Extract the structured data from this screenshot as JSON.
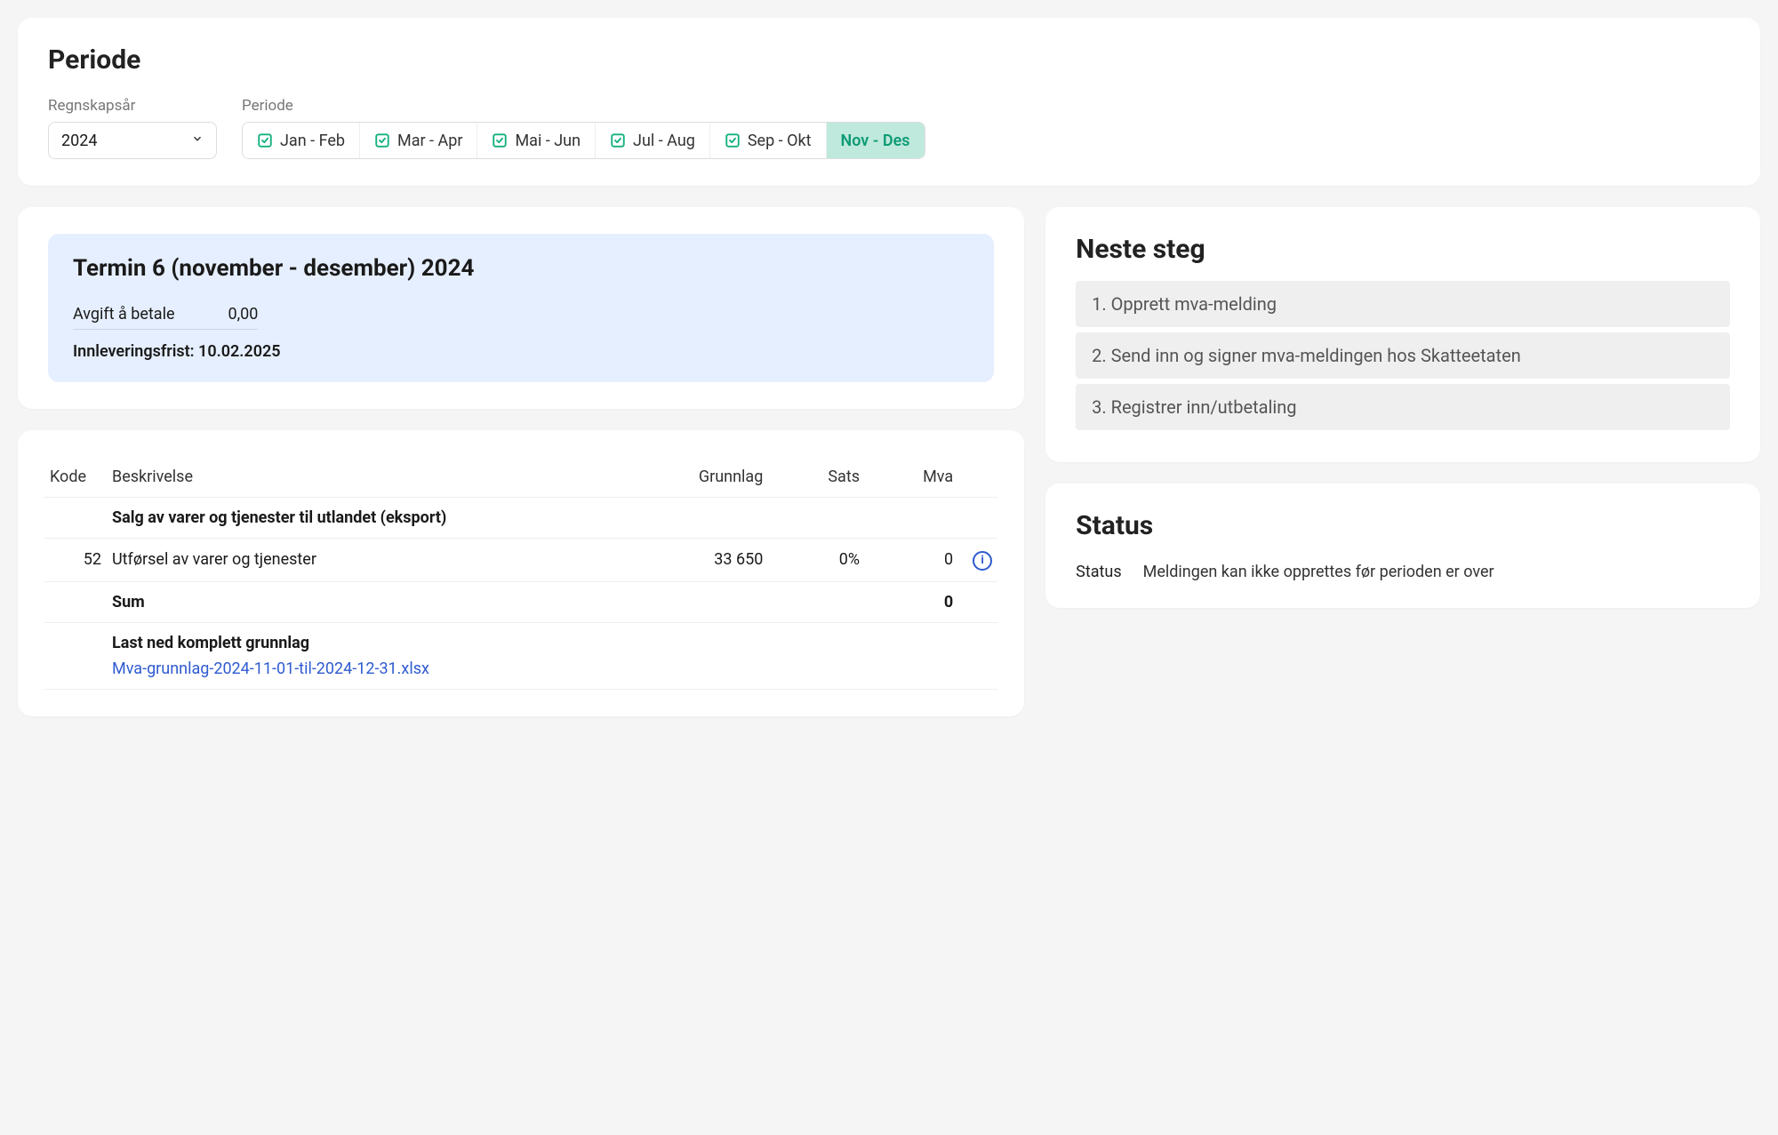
{
  "periode": {
    "title": "Periode",
    "year_label": "Regnskapsår",
    "year_value": "2024",
    "period_label": "Periode",
    "segments": [
      {
        "label": "Jan - Feb",
        "done": true,
        "active": false
      },
      {
        "label": "Mar - Apr",
        "done": true,
        "active": false
      },
      {
        "label": "Mai - Jun",
        "done": true,
        "active": false
      },
      {
        "label": "Jul - Aug",
        "done": true,
        "active": false
      },
      {
        "label": "Sep - Okt",
        "done": true,
        "active": false
      },
      {
        "label": "Nov - Des",
        "done": false,
        "active": true
      }
    ]
  },
  "summary": {
    "title": "Termin 6 (november - desember) 2024",
    "pay_label": "Avgift å betale",
    "pay_value": "0,00",
    "deadline": "Innleveringsfrist: 10.02.2025"
  },
  "table": {
    "headers": {
      "kode": "Kode",
      "besk": "Beskrivelse",
      "grunnlag": "Grunnlag",
      "sats": "Sats",
      "mva": "Mva"
    },
    "section_label": "Salg av varer og tjenester til utlandet (eksport)",
    "rows": [
      {
        "kode": "52",
        "besk": "Utførsel av varer og tjenester",
        "grunnlag": "33 650",
        "sats": "0%",
        "mva": "0"
      }
    ],
    "sum_label": "Sum",
    "sum_mva": "0",
    "download_label": "Last ned komplett grunnlag",
    "download_link": "Mva-grunnlag-2024-11-01-til-2024-12-31.xlsx"
  },
  "steps": {
    "title": "Neste steg",
    "items": [
      "1. Opprett mva-melding",
      "2. Send inn og signer mva-meldingen hos Skatteetaten",
      "3. Registrer inn/utbetaling"
    ]
  },
  "status": {
    "title": "Status",
    "label": "Status",
    "text": "Meldingen kan ikke opprettes før perioden er over"
  }
}
